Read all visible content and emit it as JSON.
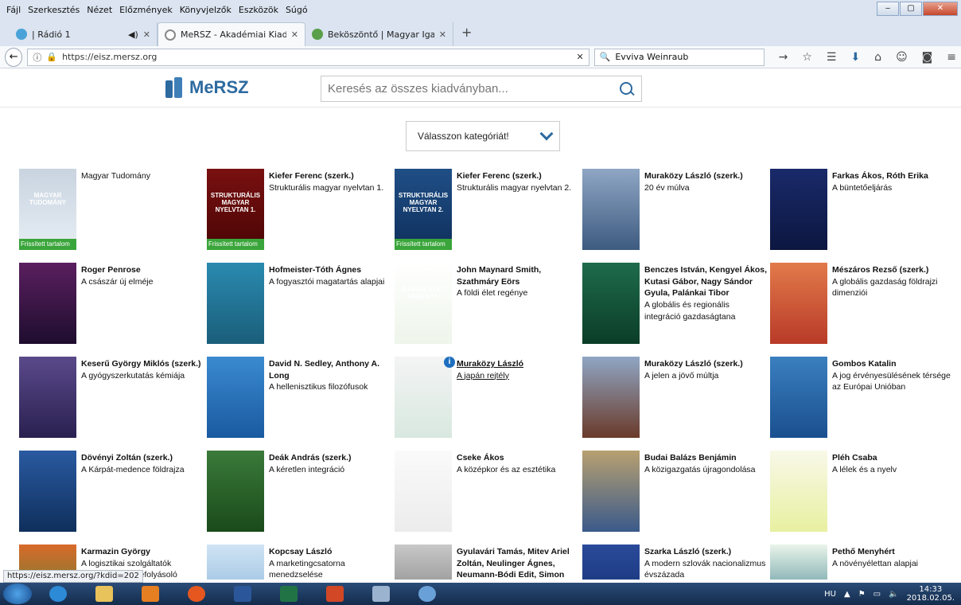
{
  "menu": [
    "Fájl",
    "Szerkesztés",
    "Nézet",
    "Előzmények",
    "Könyvjelzők",
    "Eszközök",
    "Súgó"
  ],
  "tabs": [
    {
      "title": "| Rádió 1",
      "close": "✕",
      "audio": "◀)"
    },
    {
      "title": "MeRSZ - Akadémiai Kiadó",
      "close": "✕"
    },
    {
      "title": "Beköszöntő | Magyar Igazs...",
      "close": "✕"
    }
  ],
  "newtab": "+",
  "nav": {
    "url": "https://eisz.mersz.org",
    "search": "Evviva Weinraub",
    "clear": "✕"
  },
  "site": {
    "logo": "MeRSZ",
    "search_placeholder": "Keresés az összes kiadványban...",
    "category": "Válasszon kategóriát!"
  },
  "badge_label": "Frissített tartalom",
  "books": [
    {
      "author": "",
      "title": "Magyar Tudomány",
      "badge": true,
      "cover_text": "MAGYAR TUDOMÁNY"
    },
    {
      "author": "Kiefer Ferenc (szerk.)",
      "title": "Strukturális magyar nyelvtan 1.",
      "badge": true,
      "cover_text": "STRUKTURÁLIS MAGYAR NYELVTAN 1."
    },
    {
      "author": "Kiefer Ferenc (szerk.)",
      "title": "Strukturális magyar nyelvtan 2.",
      "badge": true,
      "cover_text": "STRUKTURÁLIS MAGYAR NYELVTAN 2."
    },
    {
      "author": "Muraközy László (szerk.)",
      "title": "20 év múlva",
      "badge": false,
      "cover_text": ""
    },
    {
      "author": "Farkas Ákos, Róth Erika",
      "title": "A büntetőeljárás",
      "badge": false,
      "cover_text": ""
    },
    {
      "author": "Roger Penrose",
      "title": "A császár új elméje",
      "badge": false,
      "cover_text": ""
    },
    {
      "author": "Hofmeister-Tóth Ágnes",
      "title": "A fogyasztói magatartás alapjai",
      "badge": false,
      "cover_text": ""
    },
    {
      "author": "John Maynard Smith, Szathmáry Eörs",
      "title": "A földi élet regénye",
      "badge": false,
      "cover_text": "A FÖLDI ÉLET REGÉNYE"
    },
    {
      "author": "Benczes István, Kengyel Ákos, Kutasi Gábor, Nagy Sándor Gyula, Palánkai Tibor",
      "title": "A globális és regionális integráció gazdaságtana",
      "badge": false,
      "cover_text": ""
    },
    {
      "author": "Mészáros Rezső (szerk.)",
      "title": "A globális gazdaság földrajzi dimenziói",
      "badge": false,
      "cover_text": ""
    },
    {
      "author": "Keserű György Miklós (szerk.)",
      "title": "A gyógyszerkutatás kémiája",
      "badge": false,
      "cover_text": ""
    },
    {
      "author": "David N. Sedley, Anthony A. Long",
      "title": "A hellenisztikus filozófusok",
      "badge": false,
      "cover_text": ""
    },
    {
      "author": "Muraközy László",
      "title": "A japán rejtély",
      "badge": false,
      "cover_text": "",
      "hover": true
    },
    {
      "author": "Muraközy László (szerk.)",
      "title": "A jelen a jövő múltja",
      "badge": false,
      "cover_text": ""
    },
    {
      "author": "Gombos Katalin",
      "title": "A jog érvényesülésének térsége az Európai Unióban",
      "badge": false,
      "cover_text": ""
    },
    {
      "author": "Dövényi Zoltán (szerk.)",
      "title": "A Kárpát-medence földrajza",
      "badge": false,
      "cover_text": ""
    },
    {
      "author": "Deák András (szerk.)",
      "title": "A kéretlen integráció",
      "badge": false,
      "cover_text": ""
    },
    {
      "author": "Cseke Ákos",
      "title": "A középkor és az esztétika",
      "badge": false,
      "cover_text": ""
    },
    {
      "author": "Budai Balázs Benjámin",
      "title": "A közigazgatás újragondolása",
      "badge": false,
      "cover_text": ""
    },
    {
      "author": "Pléh Csaba",
      "title": "A lélek és a nyelv",
      "badge": false,
      "cover_text": ""
    },
    {
      "author": "Karmazin György",
      "title": "A logisztikai szolgáltatók teljesítményét befolyásoló tényezői",
      "badge": false,
      "cover_text": ""
    },
    {
      "author": "Kopcsay László",
      "title": "A marketingcsatorna menedzselése",
      "badge": false,
      "cover_text": ""
    },
    {
      "author": "Gyulavári Tamás, Mitev Ariel Zoltán, Neulinger Ágnes, Neumann-Bódi Edit, Simon",
      "title": "",
      "badge": false,
      "cover_text": ""
    },
    {
      "author": "Szarka László (szerk.)",
      "title": "A modern szlovák nacionalizmus évszázada",
      "badge": false,
      "cover_text": ""
    },
    {
      "author": "Pethő Menyhért",
      "title": "A növényélettan alapjai",
      "badge": false,
      "cover_text": ""
    }
  ],
  "status_url": "https://eisz.mersz.org/?kdid=202",
  "tray": {
    "lang": "HU",
    "time": "14:33",
    "date": "2018.02.05."
  },
  "colors": {
    "brand": "#2d6aa0",
    "badge": "#3aa53a"
  }
}
